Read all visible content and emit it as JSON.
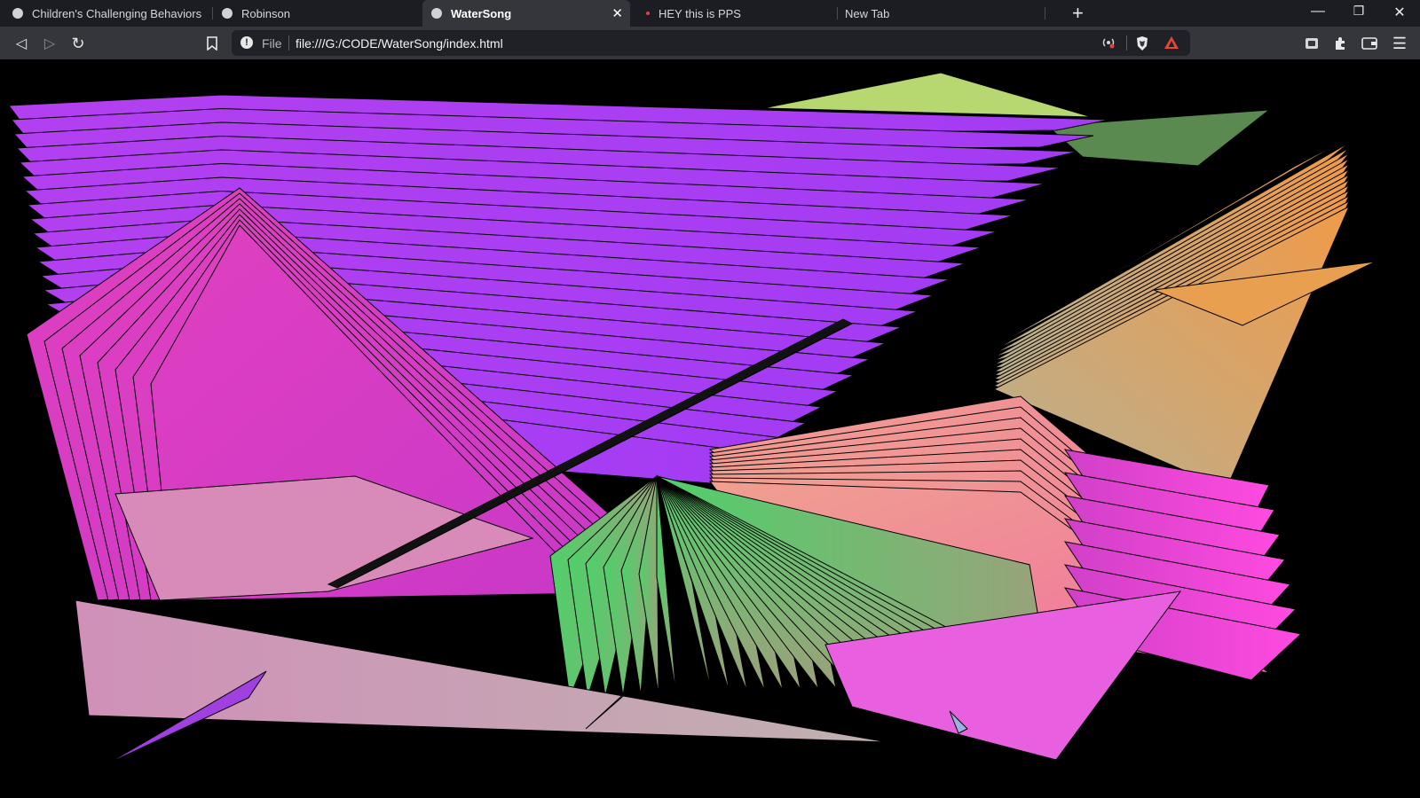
{
  "tabs": [
    {
      "title": "Children's Challenging Behaviors",
      "icon": "world-icon",
      "active": false
    },
    {
      "title": "Robinson",
      "icon": "globe-icon",
      "active": false
    },
    {
      "title": "WaterSong",
      "icon": "globe-icon",
      "active": true
    },
    {
      "title": "HEY this is PPS",
      "icon": "red-dot-icon",
      "active": false
    },
    {
      "title": "New Tab",
      "icon": "",
      "active": false
    }
  ],
  "window_controls": {
    "minimize": "—",
    "restore": "❐",
    "close": "✕"
  },
  "new_tab_symbol": "+",
  "toolbar": {
    "back": "◁",
    "forward": "▷",
    "reload": "↻",
    "bookmark": "🔖"
  },
  "address": {
    "scheme_label": "File",
    "url": "file:///G:/CODE/WaterSong/index.html",
    "info_symbol": "!"
  },
  "colors": {
    "purple": "#a93cf0",
    "magenta": "#d63ac0",
    "pink": "#f07aa2",
    "green": "#5fba74",
    "orange": "#e8a25a",
    "mauve": "#bfa3b6",
    "background": "#000000",
    "chrome_dark": "#1c1d22",
    "chrome_mid": "#35363c"
  }
}
